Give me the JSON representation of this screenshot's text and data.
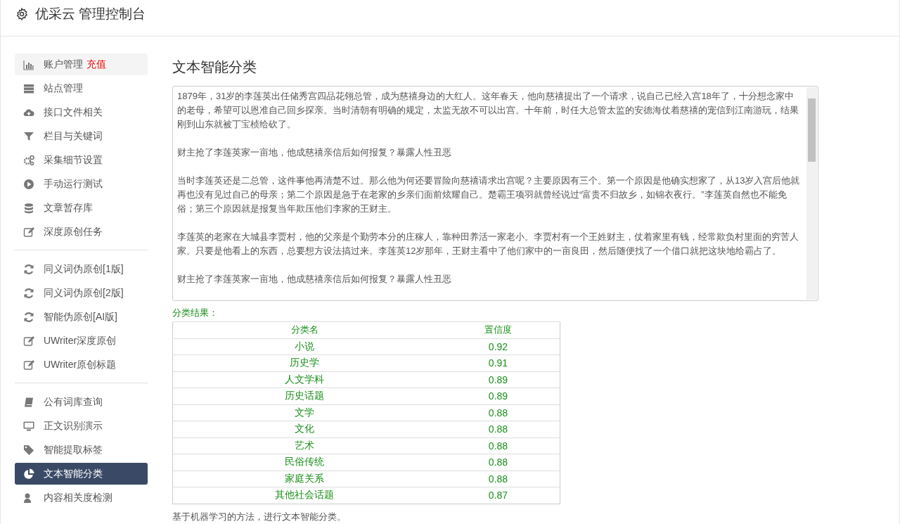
{
  "header": {
    "title": "优采云 管理控制台"
  },
  "sidebar": {
    "groups": [
      {
        "items": [
          {
            "label": "账户管理",
            "badge": "充值",
            "selected": false
          },
          {
            "label": "站点管理",
            "selected": false
          },
          {
            "label": "接口文件相关",
            "selected": false
          },
          {
            "label": "栏目与关键词",
            "selected": false
          },
          {
            "label": "采集细节设置",
            "selected": false
          },
          {
            "label": "手动运行测试",
            "selected": false
          },
          {
            "label": "文章暂存库",
            "selected": false
          },
          {
            "label": "深度原创任务",
            "selected": false
          }
        ]
      },
      {
        "items": [
          {
            "label": "同义词伪原创[1版]",
            "selected": false
          },
          {
            "label": "同义词伪原创[2版]",
            "selected": false
          },
          {
            "label": "智能伪原创[AI版]",
            "selected": false
          },
          {
            "label": "UWriter深度原创",
            "selected": false
          },
          {
            "label": "UWriter原创标题",
            "selected": false
          }
        ]
      },
      {
        "items": [
          {
            "label": "公有词库查询",
            "selected": false
          },
          {
            "label": "正文识别演示",
            "selected": false
          },
          {
            "label": "智能提取标签",
            "selected": false
          },
          {
            "label": "文本智能分类",
            "selected": true
          },
          {
            "label": "内容相关度检测",
            "selected": false
          }
        ]
      }
    ]
  },
  "main": {
    "title": "文本智能分类",
    "text_input": {
      "paragraphs": [
        "1879年，31岁的李莲英出任储秀宫四品花翎总管，成为慈禧身边的大红人。这年春天，他向慈禧提出了一个请求，说自己已经入宫18年了，十分想念家中的老母，希望可以恩准自己回乡探亲。当时清朝有明确的规定，太监无故不可以出宫。十年前，时任大总管太监的安德海仗着慈禧的宠信到江南游玩，结果刚到山东就被丁宝桢给砍了。",
        "财主抢了李莲英家一亩地，他成慈禧亲信后如何报复？暴露人性丑恶",
        "当时李莲英还是二总管，这件事他再清楚不过。那么他为何还要冒险向慈禧请求出宫呢？主要原因有三个。第一个原因是他确实想家了，从13岁入宫后他就再也没有见过自己的母亲；第二个原因是急于在老家的乡亲们面前炫耀自己。楚霸王项羽就曾经说过“富贵不归故乡，如锦衣夜行。”李莲英自然也不能免俗；第三个原因就是报复当年欺压他们李家的王财主。",
        "李莲英的老家在大城县李贾村，他的父亲是个勤劳本分的庄稼人，靠种田养活一家老小。李贾村有一个王姓财主，仗着家里有钱，经常欺负村里面的穷苦人家。只要是他看上的东西，总要想方设法搞过来。李莲英12岁那年，王财主看中了他们家中的一亩良田，然后随便找了一个借口就把这块地给霸占了。",
        "财主抢了李莲英家一亩地，他成慈禧亲信后如何报复？暴露人性丑恶"
      ]
    },
    "result_label": "分类结果：",
    "table": {
      "columns": [
        "分类名",
        "置信度"
      ],
      "rows": [
        [
          "小说",
          "0.92"
        ],
        [
          "历史学",
          "0.91"
        ],
        [
          "人文学科",
          "0.89"
        ],
        [
          "历史话题",
          "0.89"
        ],
        [
          "文学",
          "0.88"
        ],
        [
          "文化",
          "0.88"
        ],
        [
          "艺术",
          "0.88"
        ],
        [
          "民俗传统",
          "0.88"
        ],
        [
          "家庭关系",
          "0.88"
        ],
        [
          "其他社会话题",
          "0.87"
        ]
      ]
    },
    "caption": "基于机器学习的方法，进行文本智能分类。"
  }
}
